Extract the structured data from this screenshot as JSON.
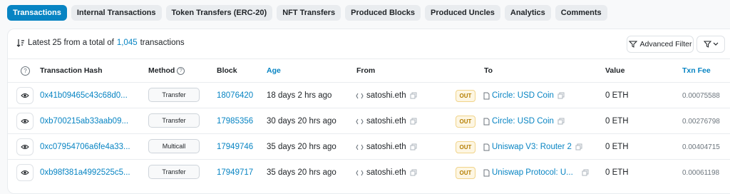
{
  "tabs": [
    {
      "label": "Transactions",
      "active": true
    },
    {
      "label": "Internal Transactions"
    },
    {
      "label": "Token Transfers (ERC-20)"
    },
    {
      "label": "NFT Transfers"
    },
    {
      "label": "Produced Blocks"
    },
    {
      "label": "Produced Uncles"
    },
    {
      "label": "Analytics"
    },
    {
      "label": "Comments"
    }
  ],
  "summary": {
    "prefix": "Latest 25 from a total of",
    "count": "1,045",
    "suffix": "transactions"
  },
  "advanced_filter_label": "Advanced Filter",
  "headers": {
    "hash": "Transaction Hash",
    "method": "Method",
    "block": "Block",
    "age": "Age",
    "from": "From",
    "to": "To",
    "value": "Value",
    "fee": "Txn Fee"
  },
  "rows": [
    {
      "hash": "0x41b09465c43c68d0...",
      "method": "Transfer",
      "block": "18076420",
      "age": "18 days 2 hrs ago",
      "from": "satoshi.eth",
      "direction": "OUT",
      "to": "Circle: USD Coin",
      "value": "0 ETH",
      "fee": "0.00075588"
    },
    {
      "hash": "0xb700215ab33aab09...",
      "method": "Transfer",
      "block": "17985356",
      "age": "30 days 20 hrs ago",
      "from": "satoshi.eth",
      "direction": "OUT",
      "to": "Circle: USD Coin",
      "value": "0 ETH",
      "fee": "0.00276798"
    },
    {
      "hash": "0xc07954706a6fe4a33...",
      "method": "Multicall",
      "block": "17949746",
      "age": "35 days 20 hrs ago",
      "from": "satoshi.eth",
      "direction": "OUT",
      "to": "Uniswap V3: Router 2",
      "value": "0 ETH",
      "fee": "0.00404715"
    },
    {
      "hash": "0xb98f381a4992525c5...",
      "method": "Transfer",
      "block": "17949717",
      "age": "35 days 20 hrs ago",
      "from": "satoshi.eth",
      "direction": "OUT",
      "to": "Uniswap Protocol: U...",
      "value": "0 ETH",
      "fee": "0.00061198"
    }
  ],
  "colors": {
    "accent": "#0784c3",
    "out_badge": "#b47d00"
  }
}
